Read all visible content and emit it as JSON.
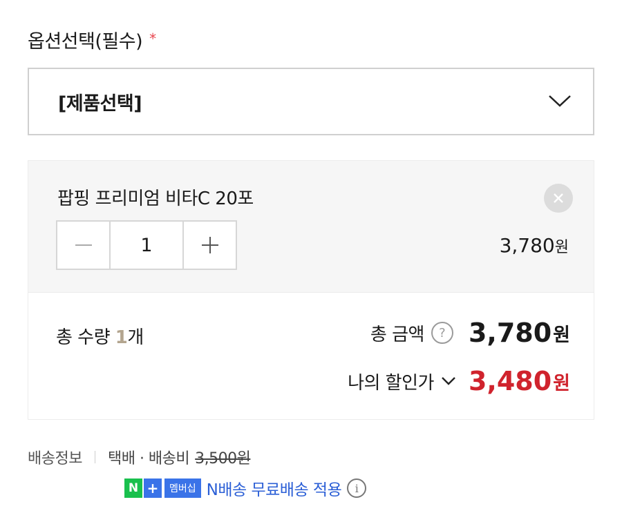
{
  "option": {
    "title": "옵션선택(필수)",
    "required_mark": "*",
    "select_value": "[제품선택]"
  },
  "item": {
    "name": "팝핑 프리미엄 비타C 20포",
    "quantity": "1",
    "price": "3,780",
    "currency": "원"
  },
  "total": {
    "qty_label": "총 수량 ",
    "qty_value": "1",
    "qty_unit": "개",
    "amount_label": "총 금액",
    "help": "?",
    "amount": "3,780",
    "currency": "원"
  },
  "discount": {
    "label": "나의 할인가",
    "amount": "3,480",
    "currency": "원",
    "color": "#d0232d"
  },
  "shipping": {
    "label": "배송정보",
    "method": "택배 · 배송비",
    "fee": "3,500원",
    "badge_n": "N",
    "badge_plus": "+",
    "badge_member": "멤버십",
    "n_delivery_text": "N배송 무료배송 적용",
    "info": "i"
  }
}
